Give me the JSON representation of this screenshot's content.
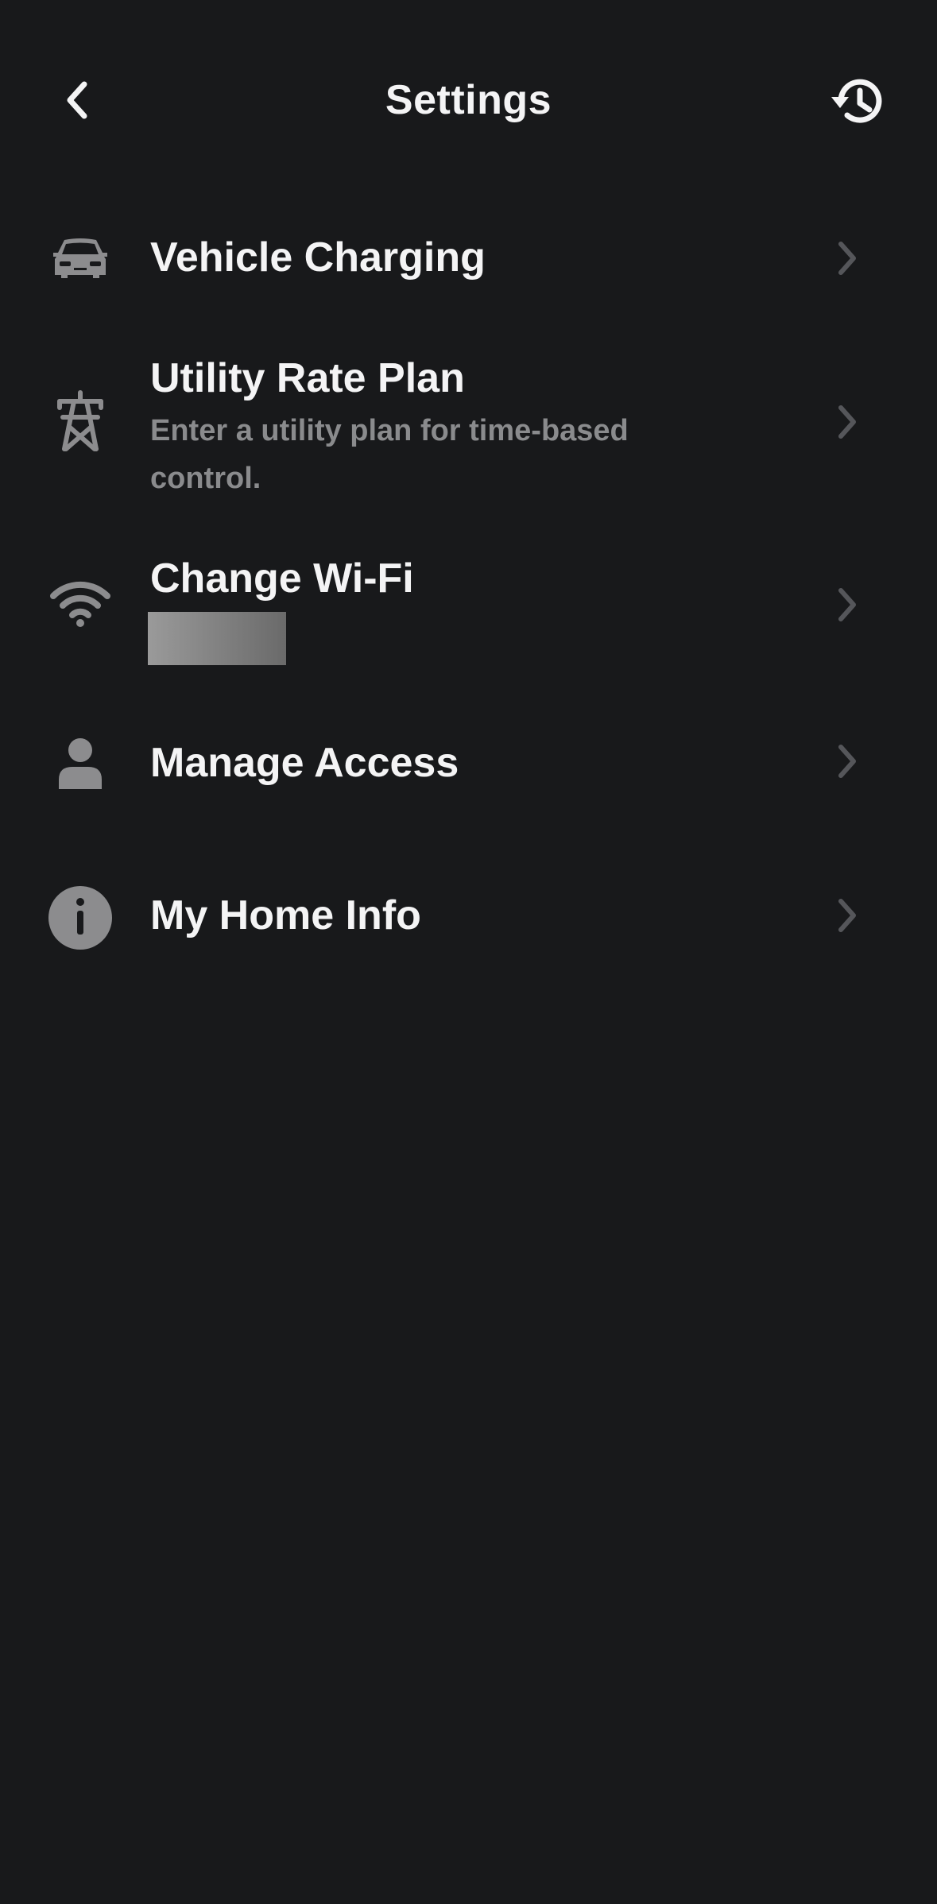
{
  "header": {
    "title": "Settings",
    "back_icon": "chevron-left-icon",
    "history_icon": "history-icon"
  },
  "colors": {
    "background": "#18191b",
    "text_primary": "#f4f4f5",
    "text_secondary": "#8a8b8d",
    "icon": "#8c8c8e",
    "chevron": "#55565a"
  },
  "settings": {
    "items": [
      {
        "title": "Vehicle Charging",
        "subtitle": "",
        "icon": "car-icon"
      },
      {
        "title": "Utility Rate Plan",
        "subtitle": "Enter a utility plan for time-based control.",
        "icon": "power-tower-icon"
      },
      {
        "title": "Change Wi-Fi",
        "subtitle": "",
        "icon": "wifi-icon"
      },
      {
        "title": "Manage Access",
        "subtitle": "",
        "icon": "person-icon"
      },
      {
        "title": "My Home Info",
        "subtitle": "",
        "icon": "info-icon"
      }
    ]
  }
}
